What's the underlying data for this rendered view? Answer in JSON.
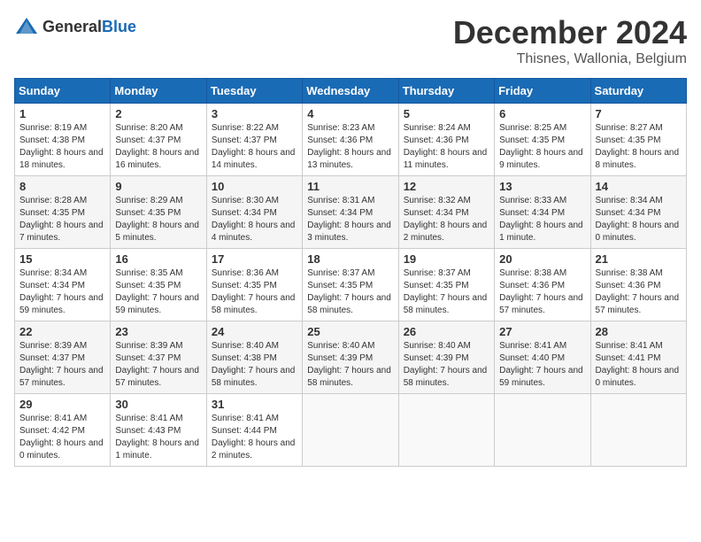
{
  "header": {
    "logo_general": "General",
    "logo_blue": "Blue",
    "month_title": "December 2024",
    "location": "Thisnes, Wallonia, Belgium"
  },
  "days_of_week": [
    "Sunday",
    "Monday",
    "Tuesday",
    "Wednesday",
    "Thursday",
    "Friday",
    "Saturday"
  ],
  "weeks": [
    [
      {
        "day": "1",
        "sunrise": "8:19 AM",
        "sunset": "4:38 PM",
        "daylight": "8 hours and 18 minutes."
      },
      {
        "day": "2",
        "sunrise": "8:20 AM",
        "sunset": "4:37 PM",
        "daylight": "8 hours and 16 minutes."
      },
      {
        "day": "3",
        "sunrise": "8:22 AM",
        "sunset": "4:37 PM",
        "daylight": "8 hours and 14 minutes."
      },
      {
        "day": "4",
        "sunrise": "8:23 AM",
        "sunset": "4:36 PM",
        "daylight": "8 hours and 13 minutes."
      },
      {
        "day": "5",
        "sunrise": "8:24 AM",
        "sunset": "4:36 PM",
        "daylight": "8 hours and 11 minutes."
      },
      {
        "day": "6",
        "sunrise": "8:25 AM",
        "sunset": "4:35 PM",
        "daylight": "8 hours and 9 minutes."
      },
      {
        "day": "7",
        "sunrise": "8:27 AM",
        "sunset": "4:35 PM",
        "daylight": "8 hours and 8 minutes."
      }
    ],
    [
      {
        "day": "8",
        "sunrise": "8:28 AM",
        "sunset": "4:35 PM",
        "daylight": "8 hours and 7 minutes."
      },
      {
        "day": "9",
        "sunrise": "8:29 AM",
        "sunset": "4:35 PM",
        "daylight": "8 hours and 5 minutes."
      },
      {
        "day": "10",
        "sunrise": "8:30 AM",
        "sunset": "4:34 PM",
        "daylight": "8 hours and 4 minutes."
      },
      {
        "day": "11",
        "sunrise": "8:31 AM",
        "sunset": "4:34 PM",
        "daylight": "8 hours and 3 minutes."
      },
      {
        "day": "12",
        "sunrise": "8:32 AM",
        "sunset": "4:34 PM",
        "daylight": "8 hours and 2 minutes."
      },
      {
        "day": "13",
        "sunrise": "8:33 AM",
        "sunset": "4:34 PM",
        "daylight": "8 hours and 1 minute."
      },
      {
        "day": "14",
        "sunrise": "8:34 AM",
        "sunset": "4:34 PM",
        "daylight": "8 hours and 0 minutes."
      }
    ],
    [
      {
        "day": "15",
        "sunrise": "8:34 AM",
        "sunset": "4:34 PM",
        "daylight": "7 hours and 59 minutes."
      },
      {
        "day": "16",
        "sunrise": "8:35 AM",
        "sunset": "4:35 PM",
        "daylight": "7 hours and 59 minutes."
      },
      {
        "day": "17",
        "sunrise": "8:36 AM",
        "sunset": "4:35 PM",
        "daylight": "7 hours and 58 minutes."
      },
      {
        "day": "18",
        "sunrise": "8:37 AM",
        "sunset": "4:35 PM",
        "daylight": "7 hours and 58 minutes."
      },
      {
        "day": "19",
        "sunrise": "8:37 AM",
        "sunset": "4:35 PM",
        "daylight": "7 hours and 58 minutes."
      },
      {
        "day": "20",
        "sunrise": "8:38 AM",
        "sunset": "4:36 PM",
        "daylight": "7 hours and 57 minutes."
      },
      {
        "day": "21",
        "sunrise": "8:38 AM",
        "sunset": "4:36 PM",
        "daylight": "7 hours and 57 minutes."
      }
    ],
    [
      {
        "day": "22",
        "sunrise": "8:39 AM",
        "sunset": "4:37 PM",
        "daylight": "7 hours and 57 minutes."
      },
      {
        "day": "23",
        "sunrise": "8:39 AM",
        "sunset": "4:37 PM",
        "daylight": "7 hours and 57 minutes."
      },
      {
        "day": "24",
        "sunrise": "8:40 AM",
        "sunset": "4:38 PM",
        "daylight": "7 hours and 58 minutes."
      },
      {
        "day": "25",
        "sunrise": "8:40 AM",
        "sunset": "4:39 PM",
        "daylight": "7 hours and 58 minutes."
      },
      {
        "day": "26",
        "sunrise": "8:40 AM",
        "sunset": "4:39 PM",
        "daylight": "7 hours and 58 minutes."
      },
      {
        "day": "27",
        "sunrise": "8:41 AM",
        "sunset": "4:40 PM",
        "daylight": "7 hours and 59 minutes."
      },
      {
        "day": "28",
        "sunrise": "8:41 AM",
        "sunset": "4:41 PM",
        "daylight": "8 hours and 0 minutes."
      }
    ],
    [
      {
        "day": "29",
        "sunrise": "8:41 AM",
        "sunset": "4:42 PM",
        "daylight": "8 hours and 0 minutes."
      },
      {
        "day": "30",
        "sunrise": "8:41 AM",
        "sunset": "4:43 PM",
        "daylight": "8 hours and 1 minute."
      },
      {
        "day": "31",
        "sunrise": "8:41 AM",
        "sunset": "4:44 PM",
        "daylight": "8 hours and 2 minutes."
      },
      null,
      null,
      null,
      null
    ]
  ]
}
